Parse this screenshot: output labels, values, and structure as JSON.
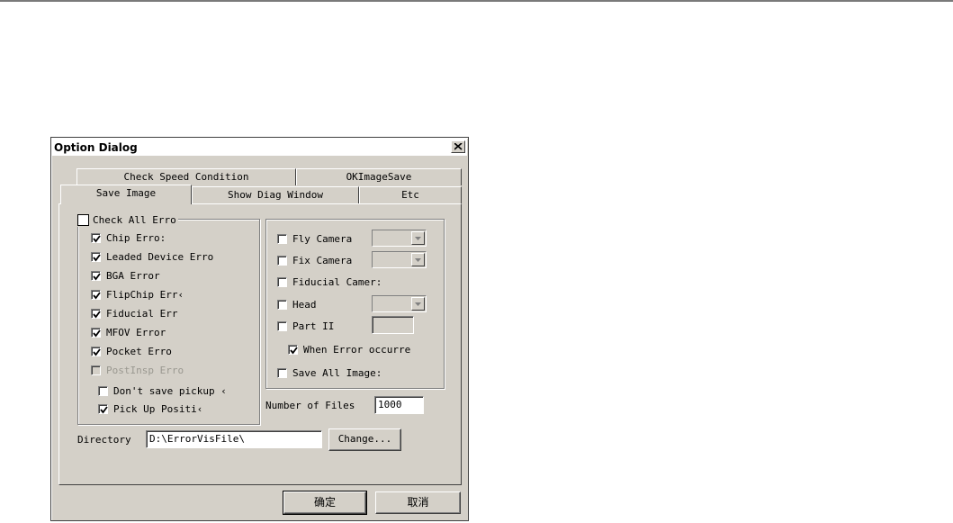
{
  "dialog": {
    "title": "Option Dialog",
    "close_icon": "close-icon"
  },
  "tabs": {
    "row1": [
      "Check Speed Condition",
      "OKImageSave"
    ],
    "row2": [
      "Save Image",
      "Show Diag Window",
      "Etc"
    ],
    "selected": "Save Image"
  },
  "errors_group": {
    "check_all": {
      "label": "Check All Erro",
      "checked": false
    },
    "items": [
      {
        "label": "Chip Erro:",
        "checked": true,
        "enabled": true
      },
      {
        "label": "Leaded Device Erro",
        "checked": true,
        "enabled": true
      },
      {
        "label": "BGA Error",
        "checked": true,
        "enabled": true
      },
      {
        "label": "FlipChip Err‹",
        "checked": true,
        "enabled": true
      },
      {
        "label": "Fiducial Err",
        "checked": true,
        "enabled": true
      },
      {
        "label": "MFOV Error",
        "checked": true,
        "enabled": true
      },
      {
        "label": "Pocket Erro",
        "checked": true,
        "enabled": true
      },
      {
        "label": "PostInsp Erro",
        "checked": false,
        "enabled": false
      }
    ],
    "dont_save_pickup": {
      "label": "Don't save pickup ‹",
      "checked": false
    },
    "pick_up_position": {
      "label": "Pick Up Positi‹",
      "checked": true
    }
  },
  "camera_group": {
    "fly_camera": {
      "label": "Fly Camera",
      "checked": false,
      "combo_value": ""
    },
    "fix_camera": {
      "label": "Fix Camera",
      "checked": false,
      "combo_value": ""
    },
    "fiducial_camera": {
      "label": "Fiducial Camer:",
      "checked": false
    },
    "head": {
      "label": "Head",
      "checked": false,
      "combo_value": ""
    },
    "part_ii": {
      "label": "Part II",
      "checked": false,
      "value": ""
    },
    "when_error": {
      "label": "When Error occurre",
      "checked": true
    },
    "save_all_images": {
      "label": "Save All Image:",
      "checked": false
    }
  },
  "number_of_files": {
    "label": "Number of Files",
    "value": "1000"
  },
  "directory": {
    "label": "Directory",
    "value": "D:\\ErrorVisFile\\",
    "change_button": "Change..."
  },
  "footer": {
    "ok_button": "确定",
    "cancel_button": "取消"
  }
}
